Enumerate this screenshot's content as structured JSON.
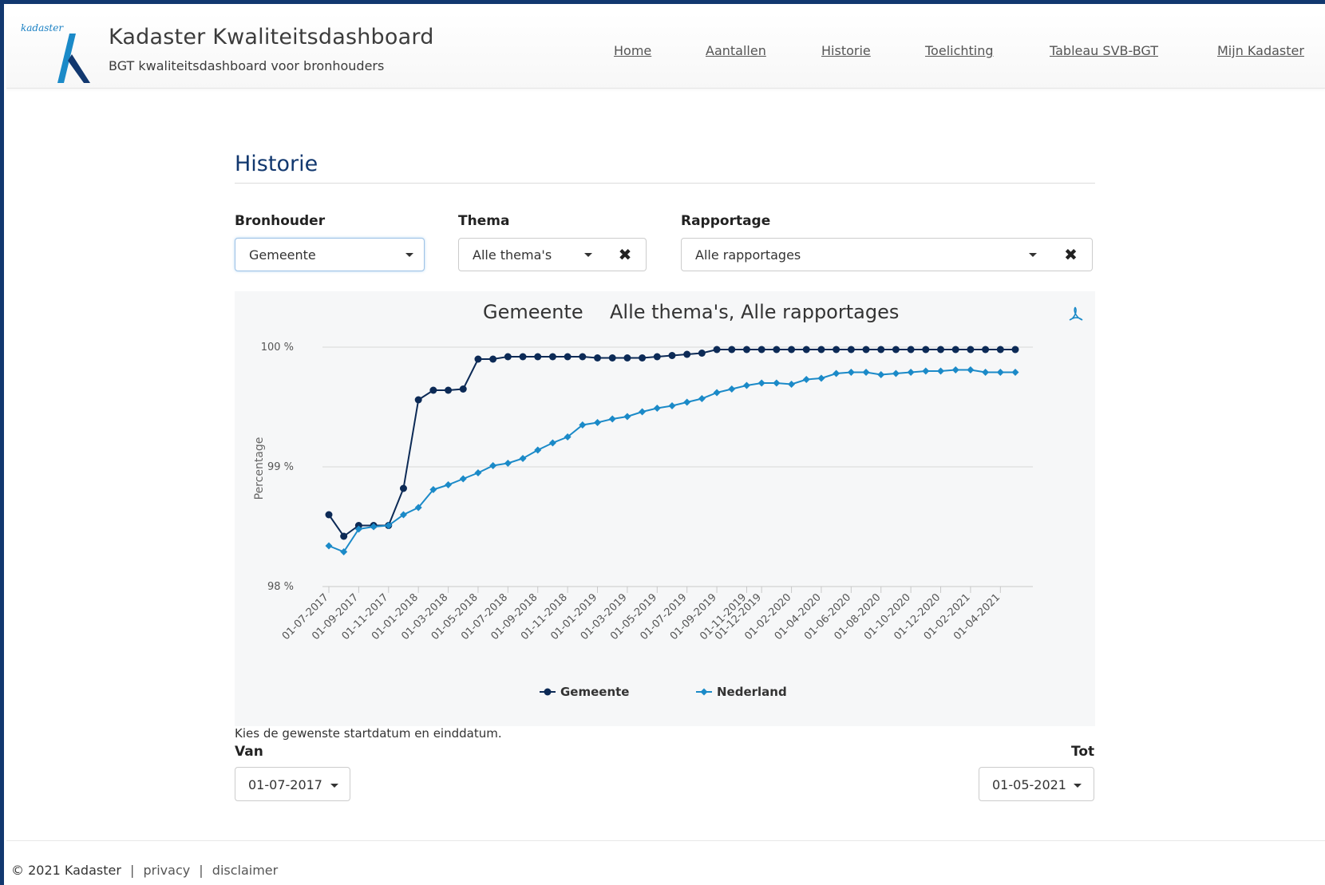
{
  "header": {
    "logo_text": "kadaster",
    "title": "Kadaster Kwaliteitsdashboard",
    "subtitle": "BGT kwaliteitsdashboard voor bronhouders",
    "nav": [
      "Home",
      "Aantallen",
      "Historie",
      "Toelichting",
      "Tableau SVB-BGT",
      "Mijn Kadaster"
    ]
  },
  "page": {
    "title": "Historie"
  },
  "filters": {
    "bronhouder": {
      "label": "Bronhouder",
      "value": "Gemeente"
    },
    "thema": {
      "label": "Thema",
      "value": "Alle thema's",
      "clear": "✖"
    },
    "rapportage": {
      "label": "Rapportage",
      "value": "Alle rapportages",
      "clear": "✖"
    }
  },
  "chart_data": {
    "type": "line",
    "title": "Gemeente",
    "subtitle": "Alle thema's, Alle rapportages",
    "ylabel": "Percentage",
    "ylim": [
      98,
      100
    ],
    "yticks": [
      "98 %",
      "99 %",
      "100 %"
    ],
    "ytick_values": [
      98,
      99,
      100
    ],
    "x": [
      "01-07-2017",
      "01-08-2017",
      "01-09-2017",
      "01-10-2017",
      "01-11-2017",
      "01-12-2017",
      "01-01-2018",
      "01-02-2018",
      "01-03-2018",
      "01-04-2018",
      "01-05-2018",
      "01-06-2018",
      "01-07-2018",
      "01-08-2018",
      "01-09-2018",
      "01-10-2018",
      "01-11-2018",
      "01-12-2018",
      "01-01-2019",
      "01-02-2019",
      "01-03-2019",
      "01-04-2019",
      "01-05-2019",
      "01-06-2019",
      "01-07-2019",
      "01-08-2019",
      "01-09-2019",
      "01-10-2019",
      "01-11-2019",
      "01-12-2019",
      "01-01-2020",
      "01-02-2020",
      "01-03-2020",
      "01-04-2020",
      "01-05-2020",
      "01-06-2020",
      "01-07-2020",
      "01-08-2020",
      "01-09-2020",
      "01-10-2020",
      "01-11-2020",
      "01-12-2020",
      "01-01-2021",
      "01-02-2021",
      "01-03-2021",
      "01-04-2021",
      "01-05-2021"
    ],
    "xticks": [
      "01-07-2017",
      "01-09-2017",
      "01-11-2017",
      "01-01-2018",
      "01-03-2018",
      "01-05-2018",
      "01-07-2018",
      "01-09-2018",
      "01-11-2018",
      "01-01-2019",
      "01-03-2019",
      "01-05-2019",
      "01-07-2019",
      "01-09-2019",
      "01-11-2019",
      "01-12-2019",
      "01-02-2020",
      "01-04-2020",
      "01-06-2020",
      "01-08-2020",
      "01-10-2020",
      "01-12-2020",
      "01-02-2021",
      "01-04-2021"
    ],
    "legend_position": "bottom",
    "series": [
      {
        "name": "Gemeente",
        "color": "#0c2a56",
        "marker": "circle",
        "values": [
          98.6,
          98.42,
          98.51,
          98.51,
          98.51,
          98.82,
          99.56,
          99.64,
          99.64,
          99.65,
          99.9,
          99.9,
          99.92,
          99.92,
          99.92,
          99.92,
          99.92,
          99.92,
          99.91,
          99.91,
          99.91,
          99.91,
          99.92,
          99.93,
          99.94,
          99.95,
          99.98,
          99.98,
          99.98,
          99.98,
          99.98,
          99.98,
          99.98,
          99.98,
          99.98,
          99.98,
          99.98,
          99.98,
          99.98,
          99.98,
          99.98,
          99.98,
          99.98,
          99.98,
          99.98,
          99.98,
          99.98
        ]
      },
      {
        "name": "Nederland",
        "color": "#1b8ac8",
        "marker": "diamond",
        "values": [
          98.34,
          98.29,
          98.48,
          98.5,
          98.51,
          98.6,
          98.66,
          98.81,
          98.85,
          98.9,
          98.95,
          99.01,
          99.03,
          99.07,
          99.14,
          99.2,
          99.25,
          99.35,
          99.37,
          99.4,
          99.42,
          99.46,
          99.49,
          99.51,
          99.54,
          99.57,
          99.62,
          99.65,
          99.68,
          99.7,
          99.7,
          99.69,
          99.73,
          99.74,
          99.78,
          99.79,
          99.79,
          99.77,
          99.78,
          99.79,
          99.8,
          99.8,
          99.81,
          99.81,
          99.79,
          99.79,
          99.79
        ]
      }
    ]
  },
  "daterange": {
    "hint": "Kies de gewenste startdatum en einddatum.",
    "from_label": "Van",
    "from_value": "01-07-2017",
    "to_label": "Tot",
    "to_value": "01-05-2021"
  },
  "footer": {
    "copyright": "© 2021 Kadaster",
    "links": [
      "privacy",
      "disclaimer"
    ],
    "separator": "|"
  }
}
